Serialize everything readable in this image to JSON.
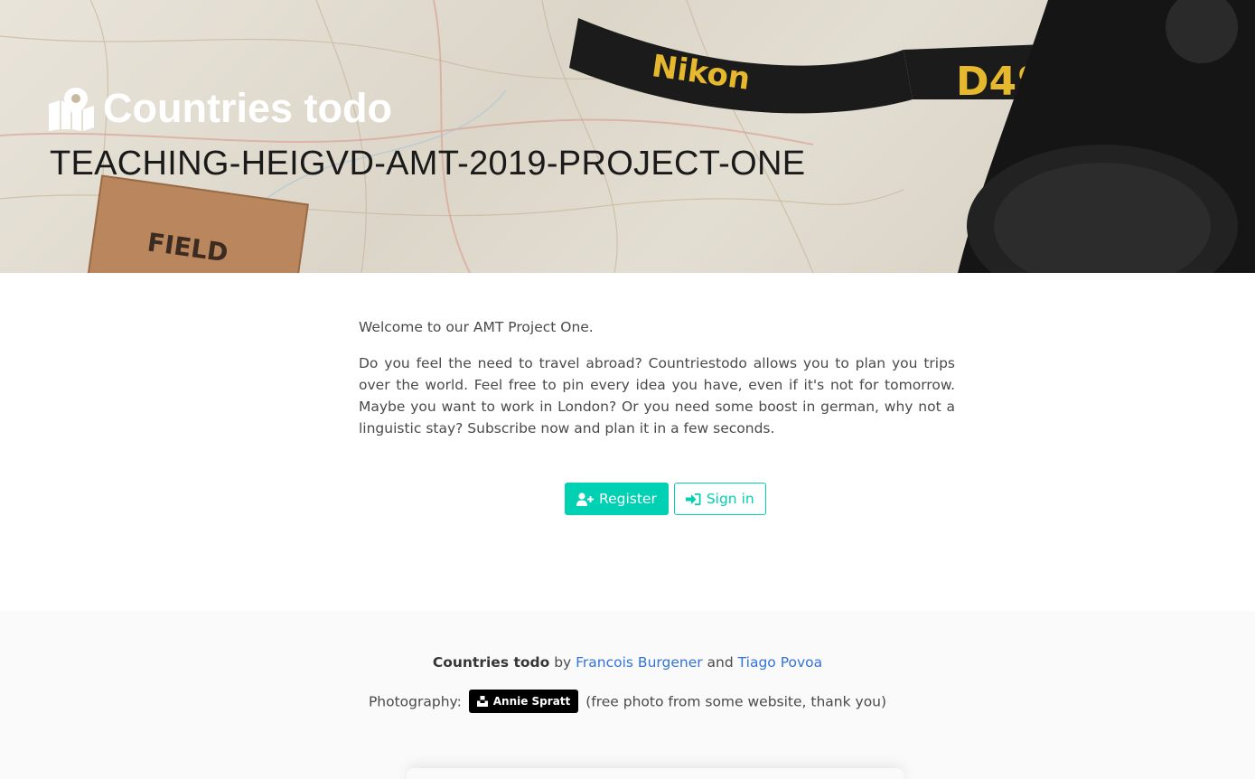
{
  "hero": {
    "brand": "Countries todo",
    "subtitle": "TEACHING-HEIGVD-AMT-2019-PROJECT-ONE",
    "photo_text": {
      "strap_1": "Nikon",
      "strap_2": "D4S",
      "notebook": "FIELD"
    }
  },
  "content": {
    "welcome": "Welcome to our AMT Project One.",
    "description": "Do you feel the need to travel abroad? Countriestodo allows you to plan you trips over the world. Feel free to pin every idea you have, even if it's not for tomorrow. Maybe you want to work in London? Or you need some boost in german, why not a linguistic stay? Subscribe now and plan it in a few seconds."
  },
  "actions": {
    "register_label": "Register",
    "signin_label": "Sign in"
  },
  "footer": {
    "app_name": "Countries todo",
    "by": "by",
    "author1": "Francois Burgener",
    "and": "and",
    "author2": "Tiago Povoa",
    "photography_label": "Photography:",
    "photographer": "Annie Spratt",
    "photo_note": "(free photo from some website, thank you)"
  },
  "colors": {
    "primary": "#00d1b2",
    "link": "#3273dc",
    "footer_bg": "#fafafa"
  },
  "icons": {
    "brand": "map-marked-icon",
    "register": "user-plus-icon",
    "signin": "sign-in-icon",
    "unsplash": "unsplash-icon"
  }
}
